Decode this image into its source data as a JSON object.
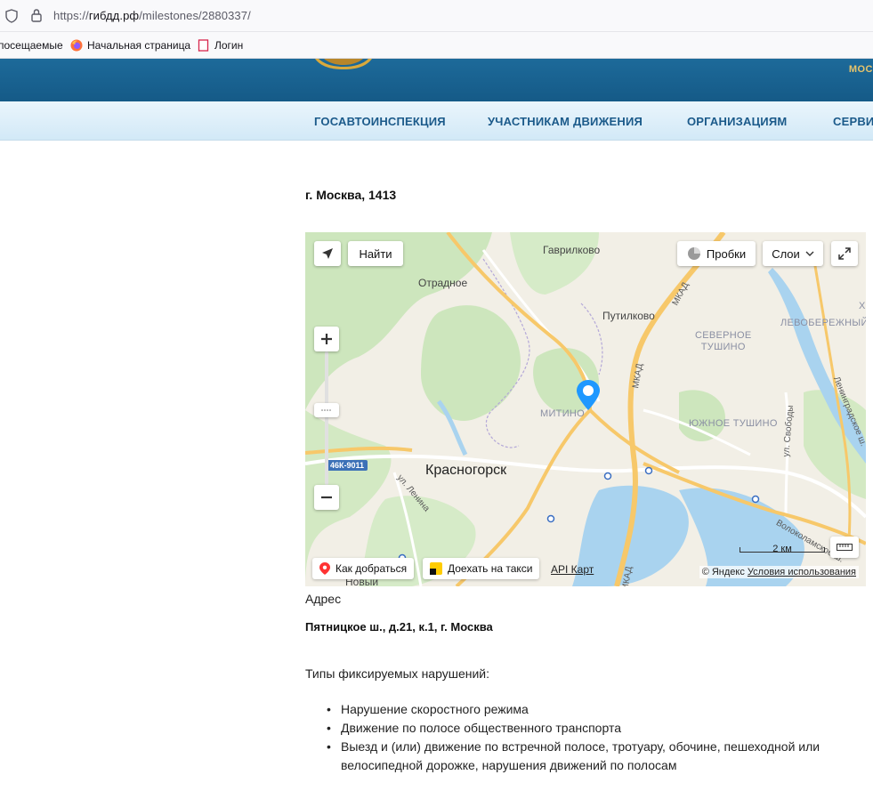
{
  "browser": {
    "url_prefix": "https://",
    "url_host": "гибдд.рф",
    "url_path": "/milestones/2880337/",
    "bookmarks": [
      "посещаемые",
      "Начальная страница",
      "Логин"
    ]
  },
  "site": {
    "header_right": "МОС",
    "nav": [
      "ГОСАВТОИНСПЕКЦИЯ",
      "УЧАСТНИКАМ ДВИЖЕНИЯ",
      "ОРГАНИЗАЦИЯМ",
      "СЕРВИС"
    ]
  },
  "content": {
    "heading": "г. Москва, 1413",
    "address_label": "Адрес",
    "address_value": "Пятницкое ш., д.21, к.1, г. Москва",
    "types_label": "Типы фиксируемых нарушений:",
    "types": [
      "Нарушение скоростного режима",
      "Движение по полосе общественного транспорта",
      "Выезд и (или) движение по встречной полосе, тротуару, обочине, пешеходной или велосипедной дорожке, нарушения движений по полосам"
    ]
  },
  "map": {
    "find_label": "Найти",
    "traffic_label": "Пробки",
    "layers_label": "Слои",
    "route_label": "Как добраться",
    "taxi_label": "Доехать на такси",
    "api_label": "API Карт",
    "copyright_prefix": "© Яндекс",
    "terms_label": "Условия использования",
    "scale_label": "2 км",
    "road_badge": "46К-9011",
    "labels": {
      "gavrilkovo": "Гаврилково",
      "otradnoe": "Отрадное",
      "putilkovo": "Путилково",
      "mkad1": "МКАД",
      "mkad2": "МКАД",
      "mkad3": "МКАД",
      "severnoe_tushino": "СЕВЕРНОЕ\nТУШИНО",
      "levoberezhny": "ЛЕВОБЕРЕЖНЫЙ",
      "mitino": "МИТИНО",
      "yuzhnoe_tushino": "ЮЖНОЕ ТУШИНО",
      "krasnogorsk": "Красногорск",
      "lenina": "ул. Ленина",
      "svobody": "ул. Свободы",
      "leningradskoe": "Ленинградское ш.",
      "volokolamskoe": "Волоколамское ш.",
      "novy": "Новый",
      "kh": "Х"
    },
    "colors": {
      "land": "#f2efe6",
      "forest": "#cde6bd",
      "water": "#a9d3ef",
      "road_major": "#f7c86a",
      "road_minor": "#ffffff",
      "marker": "#1e98ff"
    }
  }
}
